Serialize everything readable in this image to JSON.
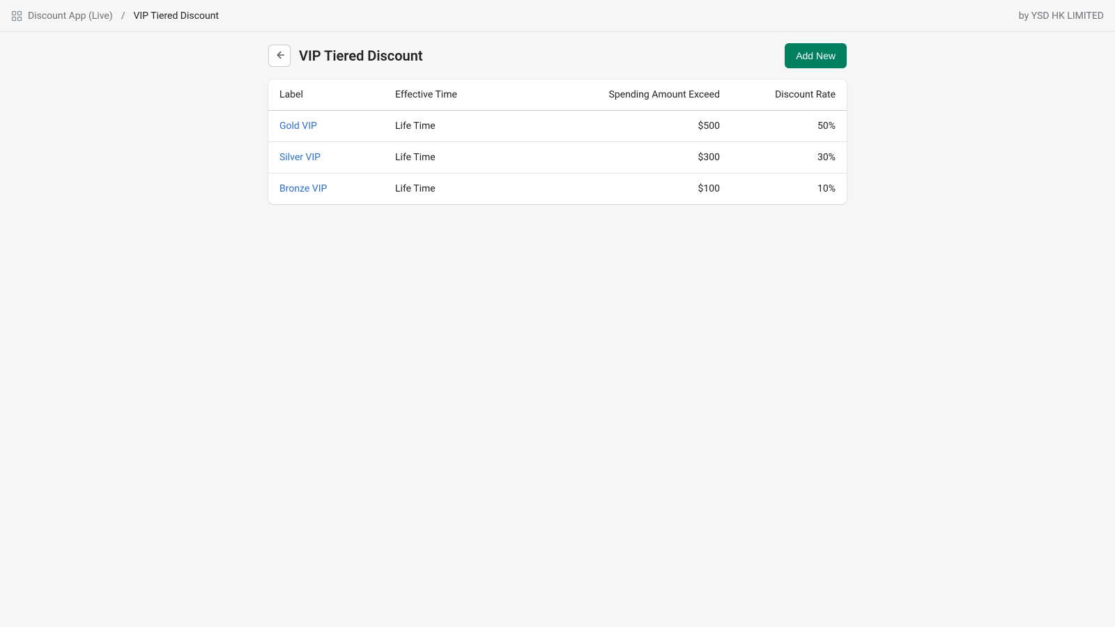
{
  "topbar": {
    "breadcrumb_root": "Discount App (Live)",
    "breadcrumb_sep": "/",
    "breadcrumb_current": "VIP Tiered Discount",
    "vendor": "by YSD HK LIMITED"
  },
  "header": {
    "title": "VIP Tiered Discount",
    "add_button": "Add New"
  },
  "table": {
    "columns": {
      "label": "Label",
      "effective_time": "Effective Time",
      "spending_amount": "Spending Amount Exceed",
      "discount_rate": "Discount Rate"
    },
    "rows": [
      {
        "label": "Gold VIP",
        "effective_time": "Life Time",
        "spending_amount": "$500",
        "discount_rate": "50%"
      },
      {
        "label": "Silver VIP",
        "effective_time": "Life Time",
        "spending_amount": "$300",
        "discount_rate": "30%"
      },
      {
        "label": "Bronze VIP",
        "effective_time": "Life Time",
        "spending_amount": "$100",
        "discount_rate": "10%"
      }
    ]
  },
  "colors": {
    "primary": "#008060",
    "link": "#2c6ecb",
    "text": "#202223",
    "muted": "#6d7175",
    "border": "#e1e3e5",
    "background": "#f6f6f7"
  }
}
